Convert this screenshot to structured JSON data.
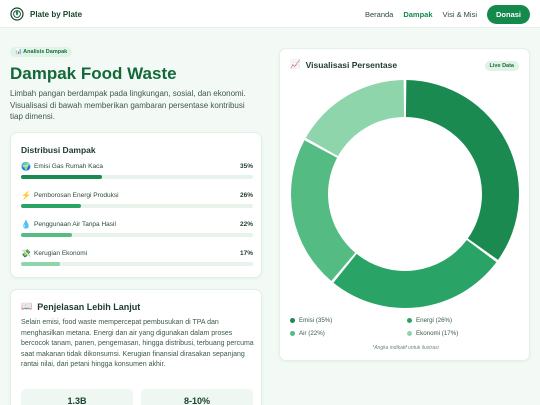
{
  "nav": {
    "brand": "Plate by Plate",
    "links": [
      "Beranda",
      "Dampak",
      "Visi & Misi"
    ],
    "active_link": "Dampak",
    "cta": "Donasi"
  },
  "hero": {
    "badge": "📊 Analisis Dampak",
    "title": "Dampak Food Waste",
    "intro": "Limbah pangan berdampak pada lingkungan, sosial, dan ekonomi. Visualisasi di bawah memberikan gambaran persentase kontribusi tiap dimensi."
  },
  "distribution": {
    "title": "Distribusi Dampak",
    "items": [
      {
        "icon": "🌍",
        "icon_name": "globe-icon",
        "label": "Emisi Gas Rumah Kaca",
        "pct_text": "35%",
        "value": 35,
        "color": "#1a8a50"
      },
      {
        "icon": "⚡",
        "icon_name": "lightning-icon",
        "label": "Pemborosan Energi Produksi",
        "pct_text": "26%",
        "value": 26,
        "color": "#2aa466"
      },
      {
        "icon": "💧",
        "icon_name": "water-drop-icon",
        "label": "Penggunaan Air Tanpa Hasil",
        "pct_text": "22%",
        "value": 22,
        "color": "#54bc82"
      },
      {
        "icon": "💸",
        "icon_name": "money-icon",
        "label": "Kerugian Ekonomi",
        "pct_text": "17%",
        "value": 17,
        "color": "#8ed5ac"
      }
    ]
  },
  "explanation": {
    "icon": "📖",
    "title": "Penjelasan Lebih Lanjut",
    "text": "Selain emisi, food waste mempercepat pembusukan di TPA dan menghasilkan metana. Energi dan air yang digunakan dalam proses bercocok tanam, panen, pengemasan, hingga distribusi, terbuang percuma saat makanan tidak dikonsumsi. Kerugian finansial dirasakan sepanjang rantai nilai, dari petani hingga konsumen akhir.",
    "stats": [
      "1.3B",
      "8-10%"
    ]
  },
  "chart_card": {
    "icon": "📈",
    "title": "Visualisasi Persentase",
    "badge": "Live Data",
    "footnote": "*Angka indikatif untuk ilustrasi"
  },
  "chart_data": {
    "type": "pie",
    "donut": true,
    "categories": [
      "Emisi",
      "Energi",
      "Air",
      "Ekonomi"
    ],
    "values": [
      35,
      26,
      22,
      17
    ],
    "colors": [
      "#1a8a50",
      "#2aa466",
      "#54bc82",
      "#8ed5ac"
    ],
    "legend": [
      "Emisi (35%)",
      "Energi (26%)",
      "Air (22%)",
      "Ekonomi (17%)"
    ],
    "legend_placement": "bottom"
  }
}
